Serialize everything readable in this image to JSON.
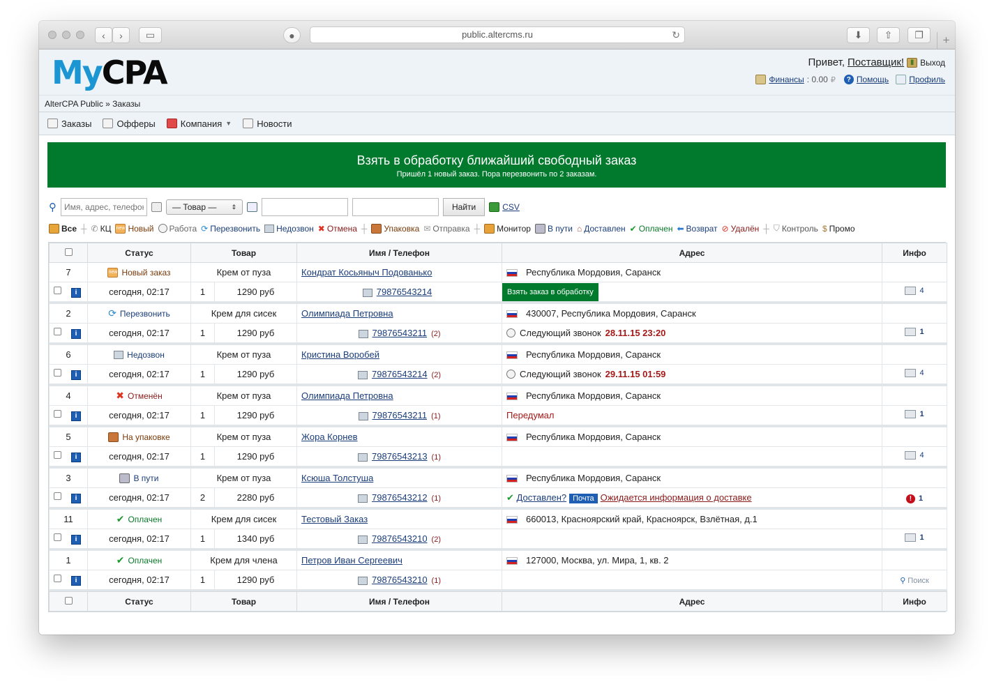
{
  "browser": {
    "url": "public.altercms.ru"
  },
  "header": {
    "logo_my": "My",
    "logo_cpa": "CPA",
    "greeting": "Привет,",
    "user": "Поставщик!",
    "logout": "Выход",
    "finance_label": "Финансы",
    "finance_value": ": 0.00",
    "help": "Помощь",
    "profile": "Профиль"
  },
  "breadcrumb": "AlterCPA Public » Заказы",
  "menu": {
    "orders": "Заказы",
    "offers": "Офферы",
    "company": "Компания",
    "news": "Новости"
  },
  "banner": {
    "title": "Взять в обработку ближайший свободный заказ",
    "subtitle": "Пришёл 1 новый заказ. Пора перезвонить по 2 заказам."
  },
  "filter": {
    "search_placeholder": "Имя, адрес, телефон",
    "product_select": "— Товар —",
    "find": "Найти",
    "csv": "CSV"
  },
  "statuses": {
    "all": "Все",
    "kc": "КЦ",
    "new": "Новый",
    "work": "Работа",
    "recall": "Перезвонить",
    "noanswer": "Недозвон",
    "cancel": "Отмена",
    "pack": "Упаковка",
    "send": "Отправка",
    "monitor": "Монитор",
    "onway": "В пути",
    "delivered": "Доставлен",
    "paid": "Оплачен",
    "return": "Возврат",
    "deleted": "Удалён",
    "control": "Контроль",
    "promo": "Промо"
  },
  "table": {
    "columns": {
      "status": "Статус",
      "product": "Товар",
      "name_phone": "Имя / Телефон",
      "address": "Адрес",
      "info": "Инфо"
    },
    "orders": [
      {
        "id": "7",
        "status": "Новый заказ",
        "status_kind": "new",
        "product": "Крем от пуза",
        "name": "Кондрат Косьяныч Подованько",
        "date": "сегодня, 02:17",
        "qty": "1",
        "price": "1290 руб",
        "phone": "79876543214",
        "calls": "",
        "address": "Республика Мордовия, Саранск",
        "extra_kind": "take",
        "extra": "Взять заказ в обработку",
        "info": "4"
      },
      {
        "id": "2",
        "status": "Перезвонить",
        "status_kind": "call",
        "product": "Крем для сисек",
        "name": "Олимпиада Петровна",
        "date": "сегодня, 02:17",
        "qty": "1",
        "price": "1290 руб",
        "phone": "79876543211",
        "calls": "(2)",
        "address": "430007, Республика Мордовия, Саранск",
        "extra_kind": "next",
        "extra": "Следующий звонок",
        "extra_time": "28.11.15 23:20",
        "info": "1"
      },
      {
        "id": "6",
        "status": "Недозвон",
        "status_kind": "no",
        "product": "Крем от пуза",
        "name": "Кристина Воробей",
        "date": "сегодня, 02:17",
        "qty": "1",
        "price": "1290 руб",
        "phone": "79876543214",
        "calls": "(2)",
        "address": "Республика Мордовия, Саранск",
        "extra_kind": "next",
        "extra": "Следующий звонок",
        "extra_time": "29.11.15 01:59",
        "info": "4"
      },
      {
        "id": "4",
        "status": "Отменён",
        "status_kind": "cancel",
        "product": "Крем от пуза",
        "name": "Олимпиада Петровна",
        "date": "сегодня, 02:17",
        "qty": "1",
        "price": "1290 руб",
        "phone": "79876543211",
        "calls": "(1)",
        "address": "Республика Мордовия, Саранск",
        "extra_kind": "reason",
        "extra": "Передумал",
        "info": "1"
      },
      {
        "id": "5",
        "status": "На упаковке",
        "status_kind": "pack",
        "product": "Крем от пуза",
        "name": "Жора Корнев",
        "date": "сегодня, 02:17",
        "qty": "1",
        "price": "1290 руб",
        "phone": "79876543213",
        "calls": "(1)",
        "address": "Республика Мордовия, Саранск",
        "extra_kind": "none",
        "extra": "",
        "info": "4"
      },
      {
        "id": "3",
        "status": "В пути",
        "status_kind": "way",
        "product": "Крем от пуза",
        "name": "Ксюша Толстуша",
        "date": "сегодня, 02:17",
        "qty": "2",
        "price": "2280 руб",
        "phone": "79876543212",
        "calls": "(1)",
        "address": "Республика Мордовия, Саранск",
        "extra_kind": "delivery",
        "extra": "Доставлен?",
        "extra_badge": "Почта",
        "extra_time": "Ожидается информация о доставке",
        "info": "1"
      },
      {
        "id": "11",
        "status": "Оплачен",
        "status_kind": "paid",
        "product": "Крем для сисек",
        "name": "Тестовый Заказ",
        "date": "сегодня, 02:17",
        "qty": "1",
        "price": "1340 руб",
        "phone": "79876543210",
        "calls": "(2)",
        "address": "660013, Красноярский край, Красноярск, Взлётная, д.1",
        "extra_kind": "none",
        "extra": "",
        "info": "1"
      },
      {
        "id": "1",
        "status": "Оплачен",
        "status_kind": "paid",
        "product": "Крем для члена",
        "name": "Петров Иван Сергеевич",
        "date": "сегодня, 02:17",
        "qty": "1",
        "price": "1290 руб",
        "phone": "79876543210",
        "calls": "(1)",
        "address": "127000, Москва, ул. Мира, 1, кв. 2",
        "extra_kind": "none",
        "extra": "",
        "info": "Поиск"
      }
    ]
  }
}
